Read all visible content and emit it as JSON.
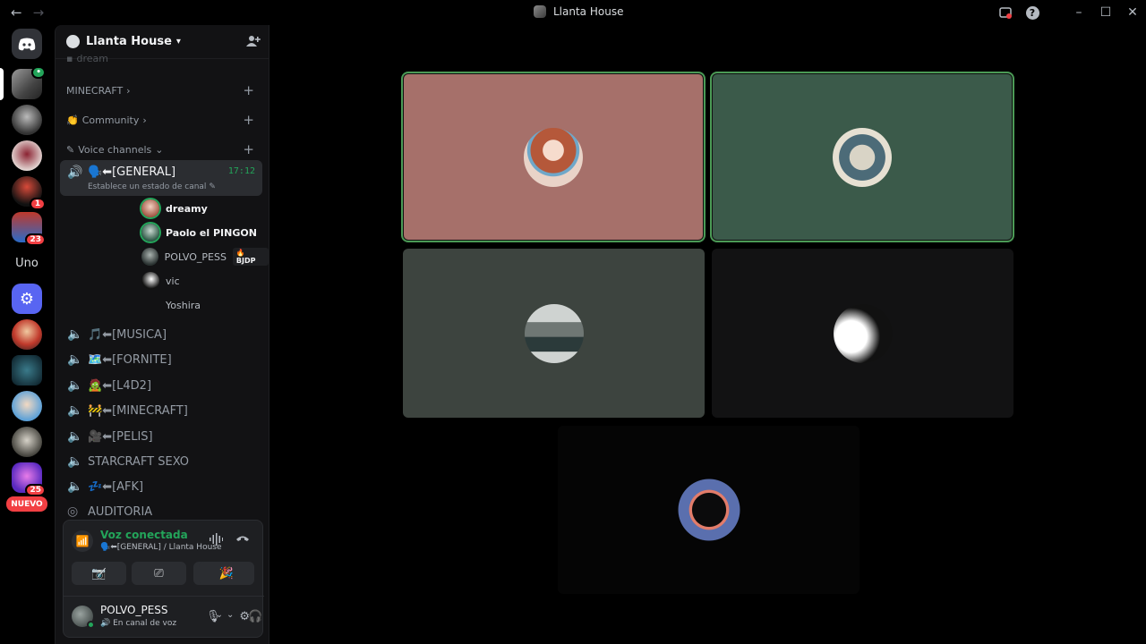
{
  "titlebar": {
    "server_title": "Llanta House",
    "back_icon": "arrow-left-icon",
    "forward_icon": "arrow-right-icon"
  },
  "rail": {
    "home_icon": "discord-logo-icon",
    "badges": [
      "1",
      "23",
      "25"
    ],
    "text_server": "Uno",
    "new_label": "NUEVO"
  },
  "server": {
    "name": "Llanta House",
    "chevron": "⌄"
  },
  "categories": {
    "truncated": "dream",
    "minecraft": "MINECRAFT",
    "community": "Community",
    "voice": "Voice channels"
  },
  "active_channel": {
    "name": "🗣️⬅[GENERAL]",
    "time": "17:12",
    "status": "Establece un estado de canal"
  },
  "voice_users": [
    {
      "name": "dreamy",
      "bold": true
    },
    {
      "name": "Paolo el PINGON",
      "bold": true
    },
    {
      "name": "POLVO_PESS",
      "bold": false,
      "tag": "BJDP"
    },
    {
      "name": "vic",
      "bold": false
    },
    {
      "name": "Yoshira",
      "bold": false
    }
  ],
  "voice_channels": [
    "🎵⬅[MUSICA]",
    "🗺️⬅[FORNITE]",
    "🧟⬅[L4D2]",
    "🚧⬅[MINECRAFT]",
    "🎥⬅[PELIS]",
    "STARCRAFT SEXO",
    "💤⬅[AFK]",
    "AUDITORIA"
  ],
  "voice_panel": {
    "title": "Voz conectada",
    "subtitle": "🗣️⬅[GENERAL] / Llanta House"
  },
  "user_panel": {
    "name": "POLVO_PESS",
    "status": "En canal de voz"
  }
}
